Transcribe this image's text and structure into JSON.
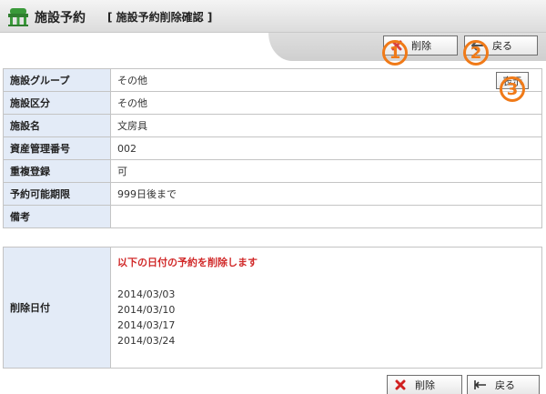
{
  "header": {
    "title": "施設予約",
    "subtitle": "[ 施設予約削除確認 ]"
  },
  "buttons": {
    "delete_label": "削除",
    "back_label": "戻る",
    "show_label": "表示"
  },
  "markers": [
    "1",
    "2",
    "3"
  ],
  "fields": [
    {
      "label": "施設グループ",
      "value": "その他"
    },
    {
      "label": "施設区分",
      "value": "その他"
    },
    {
      "label": "施設名",
      "value": "文房具"
    },
    {
      "label": "資産管理番号",
      "value": "002"
    },
    {
      "label": "重複登録",
      "value": "可"
    },
    {
      "label": "予約可能期限",
      "value": "999日後まで"
    },
    {
      "label": "備考",
      "value": ""
    }
  ],
  "delete_section": {
    "label": "削除日付",
    "message": "以下の日付の予約を削除します",
    "dates": [
      "2014/03/03",
      "2014/03/10",
      "2014/03/17",
      "2014/03/24"
    ]
  },
  "colors": {
    "marker": "#f07a18",
    "label_bg": "#e3ebf7",
    "warning": "#d12a2a"
  }
}
